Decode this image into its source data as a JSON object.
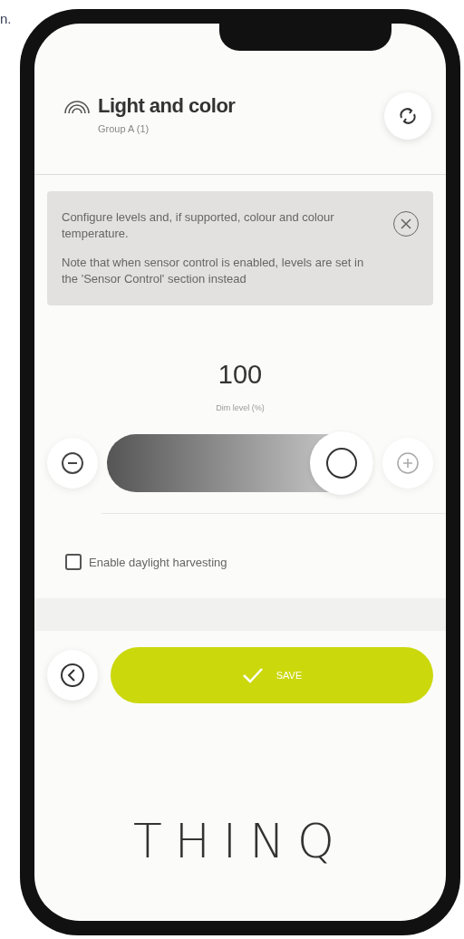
{
  "page_fragment": "n.",
  "header": {
    "title": "Light and color",
    "subtitle": "Group A (1)"
  },
  "info": {
    "paragraphs": [
      "Configure levels and, if supported, colour and colour temperature.",
      "Note that when sensor control is enabled, levels are set in the 'Sensor Control' section instead"
    ]
  },
  "dim": {
    "value": "100",
    "label": "Dim level (%)",
    "level": 1
  },
  "options": [
    {
      "label": "Enable daylight harvesting",
      "checked": false
    }
  ],
  "save_button": {
    "label": "SAVE"
  },
  "logo": "THINQ"
}
